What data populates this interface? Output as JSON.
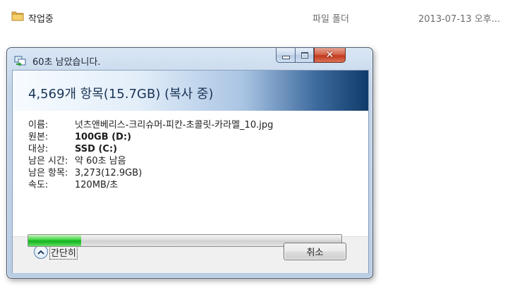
{
  "explorer_row": {
    "name": "작업중",
    "type": "파일 폴더",
    "date": "2013-07-13 오후..."
  },
  "dialog": {
    "title": "60초 남았습니다.",
    "header": "4,569개 항목(15.7GB) (복사 중)",
    "details": [
      {
        "label": "이름:",
        "value": "넛츠앤베리스-크리슈머-피칸-초콜릿-카라멜_10.jpg",
        "bold": false
      },
      {
        "label": "원본:",
        "value": "100GB (D:)",
        "bold": true
      },
      {
        "label": "대상:",
        "value": "SSD (C:)",
        "bold": true
      },
      {
        "label": "남은 시간:",
        "value": "약 60초 남음",
        "bold": false
      },
      {
        "label": "남은 항목:",
        "value": "3,273(12.9GB)",
        "bold": false
      },
      {
        "label": "속도:",
        "value": "120MB/초",
        "bold": false
      }
    ],
    "progress_fraction": 0.17,
    "less_details_label": "간단히",
    "cancel_label": "취소"
  },
  "colors": {
    "progress_green": "#12b21e",
    "header_dark_blue": "#0f3a69",
    "close_red": "#c3391b"
  },
  "icons": [
    "folder-icon",
    "copy-icon",
    "minimize-icon",
    "maximize-icon",
    "close-icon",
    "chevron-up-icon"
  ]
}
